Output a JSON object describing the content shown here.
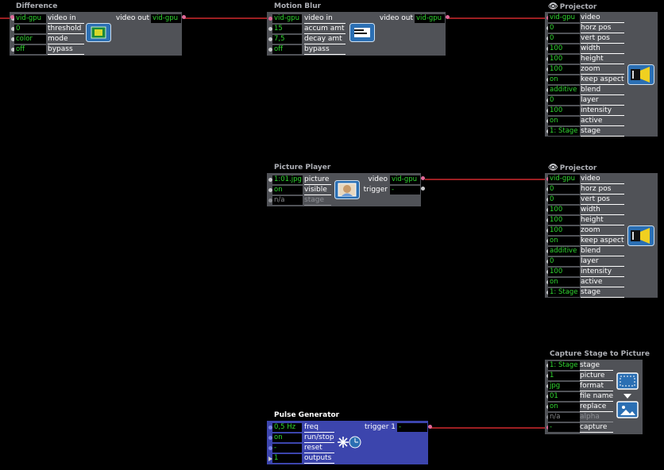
{
  "actors": {
    "difference": {
      "title": "Difference",
      "inputs": [
        {
          "value": "vid-gpu",
          "label": "video in"
        },
        {
          "value": "0",
          "label": "threshold"
        },
        {
          "value": "color",
          "label": "mode"
        },
        {
          "value": "off",
          "label": "bypass"
        }
      ],
      "output": {
        "label": "video out",
        "value": "vid-gpu"
      },
      "icon": "difference-icon"
    },
    "motion_blur": {
      "title": "Motion Blur",
      "inputs": [
        {
          "value": "vid-gpu",
          "label": "video in"
        },
        {
          "value": "15",
          "label": "accum amt"
        },
        {
          "value": "7,5",
          "label": "decay amt"
        },
        {
          "value": "off",
          "label": "bypass"
        }
      ],
      "output": {
        "label": "video out",
        "value": "vid-gpu"
      },
      "icon": "motion-blur-icon"
    },
    "projector_1": {
      "title": "Projector",
      "inputs": [
        {
          "value": "vid-gpu",
          "label": "video"
        },
        {
          "value": "0",
          "label": "horz pos"
        },
        {
          "value": "0",
          "label": "vert pos"
        },
        {
          "value": "100",
          "label": "width"
        },
        {
          "value": "100",
          "label": "height"
        },
        {
          "value": "100",
          "label": "zoom"
        },
        {
          "value": "on",
          "label": "keep aspect"
        },
        {
          "value": "additive",
          "label": "blend"
        },
        {
          "value": "0",
          "label": "layer"
        },
        {
          "value": "100",
          "label": "intensity"
        },
        {
          "value": "on",
          "label": "active"
        },
        {
          "value": "1: Stage",
          "label": "stage"
        }
      ],
      "icon": "projector-icon"
    },
    "picture_player": {
      "title": "Picture Player",
      "inputs": [
        {
          "value": "1:01.jpg",
          "label": "picture"
        },
        {
          "value": "on",
          "label": "visible"
        },
        {
          "value": "n/a",
          "label": "stage"
        }
      ],
      "outputs": [
        {
          "label": "video",
          "value": "vid-gpu"
        },
        {
          "label": "trigger",
          "value": "-"
        }
      ],
      "icon": "picture-icon"
    },
    "projector_2": {
      "title": "Projector",
      "inputs": [
        {
          "value": "vid-gpu",
          "label": "video"
        },
        {
          "value": "0",
          "label": "horz pos"
        },
        {
          "value": "0",
          "label": "vert pos"
        },
        {
          "value": "100",
          "label": "width"
        },
        {
          "value": "100",
          "label": "height"
        },
        {
          "value": "100",
          "label": "zoom"
        },
        {
          "value": "on",
          "label": "keep aspect"
        },
        {
          "value": "additive",
          "label": "blend"
        },
        {
          "value": "0",
          "label": "layer"
        },
        {
          "value": "100",
          "label": "intensity"
        },
        {
          "value": "on",
          "label": "active"
        },
        {
          "value": "1: Stage",
          "label": "stage"
        }
      ],
      "icon": "projector-icon"
    },
    "capture": {
      "title": "Capture Stage to Picture",
      "inputs": [
        {
          "value": "1: Stage",
          "label": "stage"
        },
        {
          "value": "1",
          "label": "picture"
        },
        {
          "value": "jpg",
          "label": "format"
        },
        {
          "value": "01",
          "label": "file name"
        },
        {
          "value": "on",
          "label": "replace"
        },
        {
          "value": "n/a",
          "label": "alpha"
        },
        {
          "value": "-",
          "label": "capture"
        }
      ],
      "icon": "capture-icon"
    },
    "pulse_generator": {
      "title": "Pulse Generator",
      "inputs": [
        {
          "value": "0,5 Hz",
          "label": "freq"
        },
        {
          "value": "on",
          "label": "run/stop"
        },
        {
          "value": "-",
          "label": "reset"
        },
        {
          "value": "1",
          "label": "outputs"
        }
      ],
      "output": {
        "label": "trigger 1",
        "value": "-"
      },
      "icon": "pulse-icon"
    }
  },
  "colors": {
    "wire": "#9c1f22",
    "value_text": "#2fd62f",
    "actor_bg": "#505257",
    "pulse_bg": "#3c45ad"
  }
}
